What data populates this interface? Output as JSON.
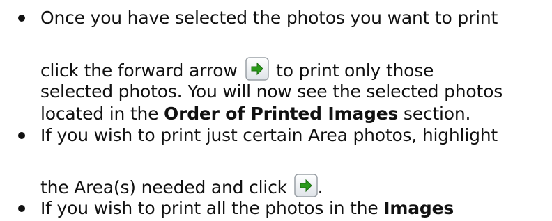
{
  "items": [
    {
      "line1": "Once you have selected the photos you want to print",
      "line2_before": "click the forward arrow",
      "line2_after": "to print only those",
      "line3": "selected photos. You will now see the selected photos",
      "line4_before": "located in the",
      "line4_bold": "Order of Printed Images",
      "line4_after": "section."
    },
    {
      "line1": "If you wish to print just certain Area photos, highlight",
      "line2_before": "the Area(s) needed and click",
      "line2_after": "."
    },
    {
      "line1_before": "If you wish to print all the photos in the",
      "line1_bold": "Images"
    }
  ],
  "icons": {
    "forward_arrow": "forward-arrow-icon",
    "arrow_color": "#2a9a1a",
    "button_border": "#9aa0a6"
  }
}
